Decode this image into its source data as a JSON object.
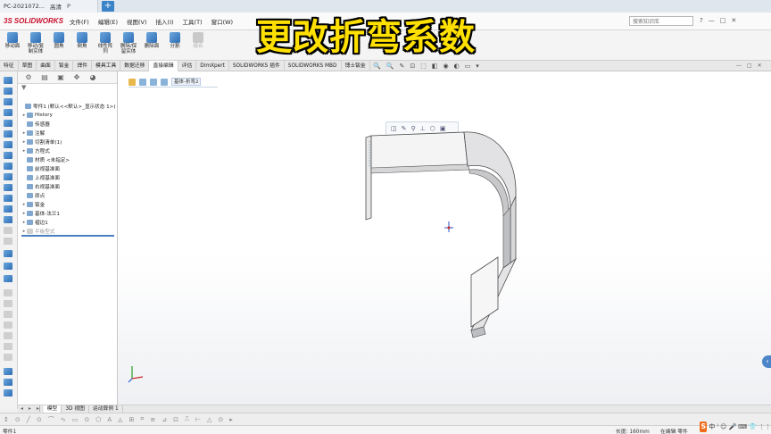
{
  "browser": {
    "tabs": [
      {
        "title": "PC-2021072...",
        "tag": "高清",
        "extra": "P"
      }
    ],
    "new_tab": "+"
  },
  "app": {
    "logo": "SOLIDWORKS",
    "logo_mark": "3S",
    "menu": [
      "文件(F)",
      "编辑(E)",
      "视图(V)",
      "插入(I)",
      "工具(T)",
      "窗口(W)"
    ],
    "document_title": "零件1 *",
    "search_placeholder": "搜索知识库",
    "title_icons": [
      "?",
      "—",
      "□",
      "✕"
    ]
  },
  "overlay": {
    "title": "更改折弯系数"
  },
  "ribbon": {
    "buttons": [
      {
        "label": "移动面",
        "dim": false
      },
      {
        "label": "移动/复制实体",
        "dim": false
      },
      {
        "label": "圆角",
        "dim": false
      },
      {
        "label": "倒角",
        "dim": false
      },
      {
        "label": "线性阵列",
        "dim": false
      },
      {
        "label": "删除/保留实体",
        "dim": false
      },
      {
        "label": "删除面",
        "dim": false
      },
      {
        "label": "分割",
        "dim": false
      },
      {
        "label": "组合",
        "dim": true
      }
    ]
  },
  "command_tabs": {
    "items": [
      "特征",
      "草图",
      "曲面",
      "钣金",
      "焊件",
      "模具工具",
      "数据迁移",
      "直接编辑",
      "评估",
      "DimXpert",
      "SOLIDWORKS 插件",
      "SOLIDWORKS MBD",
      "博士钣金"
    ],
    "active_index": 7
  },
  "heads_up": [
    "🔍",
    "🔍",
    "✎",
    "⊡",
    "⬚",
    "◧",
    "◉",
    "◐",
    "▭",
    "▾"
  ],
  "window_controls": [
    "—",
    "□",
    "✕"
  ],
  "feature_manager": {
    "tabs": [
      "⚙",
      "▤",
      "▣",
      "✥",
      "◕"
    ],
    "filter": "▼",
    "tree": [
      {
        "label": "零件1 (默认<<默认>_显示状态 1>)",
        "expand": "",
        "level": 0,
        "dim": false
      },
      {
        "label": "History",
        "expand": "▸",
        "level": 1,
        "dim": false
      },
      {
        "label": "传感器",
        "expand": "",
        "level": 1,
        "dim": false
      },
      {
        "label": "注解",
        "expand": "▸",
        "level": 1,
        "dim": false
      },
      {
        "label": "切割清单(1)",
        "expand": "▸",
        "level": 1,
        "dim": false
      },
      {
        "label": "方程式",
        "expand": "▸",
        "level": 1,
        "dim": false
      },
      {
        "label": "材质 <未指定>",
        "expand": "",
        "level": 1,
        "dim": false
      },
      {
        "label": "前视基准面",
        "expand": "",
        "level": 1,
        "dim": false
      },
      {
        "label": "上视基准面",
        "expand": "",
        "level": 1,
        "dim": false
      },
      {
        "label": "右视基准面",
        "expand": "",
        "level": 1,
        "dim": false
      },
      {
        "label": "原点",
        "expand": "",
        "level": 1,
        "dim": false
      },
      {
        "label": "钣金",
        "expand": "▸",
        "level": 1,
        "dim": false
      },
      {
        "label": "基体-法兰1",
        "expand": "▸",
        "level": 1,
        "dim": false
      },
      {
        "label": "褶边1",
        "expand": "▸",
        "level": 1,
        "dim": false
      },
      {
        "label": "平板型式",
        "expand": "▸",
        "level": 1,
        "dim": true
      }
    ]
  },
  "viewport": {
    "breadcrumb_label": "基体-折弯2",
    "ctx_row1": [
      "◫",
      "✎",
      "⚲",
      "⊥",
      "⬡",
      "▣"
    ],
    "ctx_row2": [
      "👤",
      "▾"
    ],
    "side_arrow": "‹"
  },
  "model_tabs": {
    "nav": [
      "◂",
      "▸",
      "▸|"
    ],
    "items": [
      "模型",
      "3D 视图",
      "运动算例 1"
    ],
    "active_index": 0
  },
  "sketch_bar": [
    "↕",
    "⊙",
    "╱",
    "⊙",
    "⌒",
    "∿",
    "▭",
    "⊙",
    "⬠",
    "A",
    "◬",
    "⊞",
    "⌗",
    "≡",
    "⊿",
    "⊡",
    "⎍",
    "⊢",
    "△",
    "⊙",
    "▸"
  ],
  "status": {
    "left": "零件1",
    "length": "长度: 160mm",
    "edit_state": "在编辑 零件"
  },
  "ime": {
    "logo": "S",
    "text": "中",
    "icons": [
      "⁾",
      "☺",
      "🎤",
      "⌨",
      "👕",
      "⋮⋮"
    ]
  }
}
